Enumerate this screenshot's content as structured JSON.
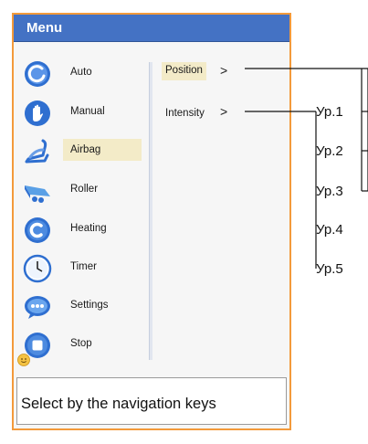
{
  "menu": {
    "title": "Menu",
    "items": [
      {
        "label": "Auto",
        "icon": "power-icon"
      },
      {
        "label": "Manual",
        "icon": "hand-icon"
      },
      {
        "label": "Airbag",
        "icon": "chair-icon"
      },
      {
        "label": "Roller",
        "icon": "roller-icon"
      },
      {
        "label": "Heating",
        "icon": "heating-icon"
      },
      {
        "label": "Timer",
        "icon": "clock-icon"
      },
      {
        "label": "Settings",
        "icon": "settings-icon"
      },
      {
        "label": "Stop",
        "icon": "stop-icon"
      }
    ],
    "selected_item": "Airbag"
  },
  "submenu": {
    "items": [
      {
        "label": "Position",
        "chevron": ">"
      },
      {
        "label": "Intensity",
        "chevron": ">"
      }
    ],
    "selected_item": "Position"
  },
  "hint": {
    "text": "Select by the navigation keys"
  },
  "levels": [
    "Ур.1",
    "Ур.2",
    "Ур.3",
    "Ур.4",
    "Ур.5"
  ],
  "colors": {
    "header": "#4472c4",
    "panel_border": "#f39a3b",
    "selection": "#f3ebc8",
    "icon_blue": "#2f6fd0"
  }
}
